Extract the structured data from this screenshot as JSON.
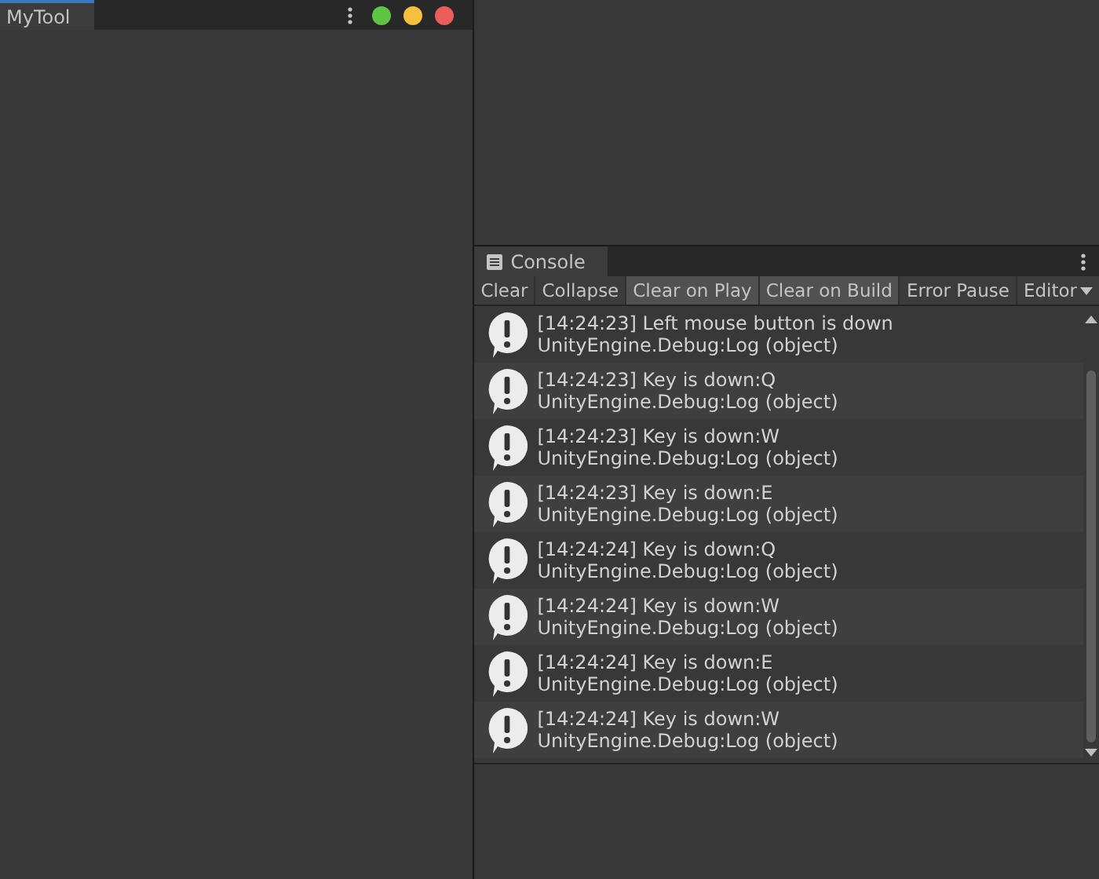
{
  "left_panel": {
    "tabs": [
      {
        "label": "MyTool",
        "selected": true
      }
    ],
    "window_buttons": [
      {
        "color": "#5ec544"
      },
      {
        "color": "#f6bf3c"
      },
      {
        "color": "#eb5e57"
      }
    ]
  },
  "console": {
    "tab": {
      "label": "Console",
      "selected": true
    },
    "toolbar": [
      {
        "kind": "button",
        "label": "Clear",
        "on": false
      },
      {
        "kind": "toggle",
        "label": "Collapse",
        "on": false
      },
      {
        "kind": "toggle",
        "label": "Clear on Play",
        "on": true
      },
      {
        "kind": "toggle",
        "label": "Clear on Build",
        "on": true
      },
      {
        "kind": "toggle",
        "label": "Error Pause",
        "on": false
      },
      {
        "kind": "dropdown",
        "label": "Editor",
        "on": false
      }
    ],
    "entries": [
      {
        "message": "[14:24:23] Left mouse button is down",
        "source": "UnityEngine.Debug:Log (object)"
      },
      {
        "message": "[14:24:23] Key is down:Q",
        "source": "UnityEngine.Debug:Log (object)"
      },
      {
        "message": "[14:24:23] Key is down:W",
        "source": "UnityEngine.Debug:Log (object)"
      },
      {
        "message": "[14:24:23] Key is down:E",
        "source": "UnityEngine.Debug:Log (object)"
      },
      {
        "message": "[14:24:24] Key is down:Q",
        "source": "UnityEngine.Debug:Log (object)"
      },
      {
        "message": "[14:24:24] Key is down:W",
        "source": "UnityEngine.Debug:Log (object)"
      },
      {
        "message": "[14:24:24] Key is down:E",
        "source": "UnityEngine.Debug:Log (object)"
      },
      {
        "message": "[14:24:24] Key is down:W",
        "source": "UnityEngine.Debug:Log (object)"
      }
    ]
  }
}
